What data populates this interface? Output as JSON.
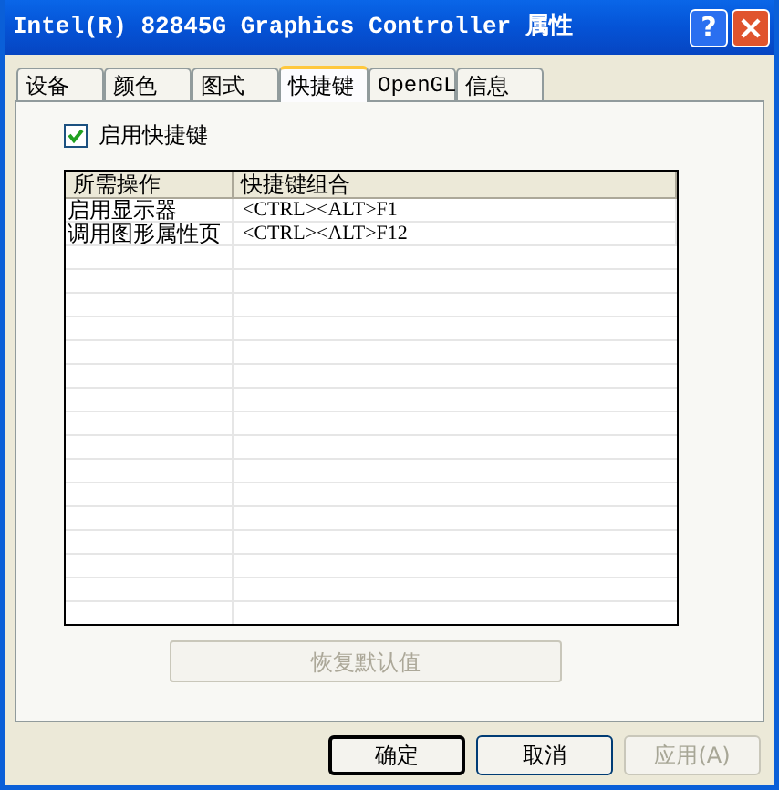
{
  "window": {
    "title": "Intel(R) 82845G Graphics Controller 属性",
    "help_button": "?"
  },
  "tabs": [
    {
      "label": "设备",
      "selected": false
    },
    {
      "label": "颜色",
      "selected": false
    },
    {
      "label": "图式",
      "selected": false
    },
    {
      "label": "快捷键",
      "selected": true
    },
    {
      "label": "OpenGL",
      "selected": false
    },
    {
      "label": "信息",
      "selected": false
    }
  ],
  "hotkey_checkbox": {
    "label": "启用快捷键",
    "checked": true
  },
  "table": {
    "columns": [
      "所需操作",
      "快捷键组合"
    ],
    "rows": [
      [
        "启用显示器",
        "<CTRL><ALT>F1"
      ],
      [
        "调用图形属性页",
        "<CTRL><ALT>F12"
      ]
    ]
  },
  "restore_button": {
    "label": "恢复默认值",
    "disabled": true
  },
  "buttons": [
    {
      "label": "确定",
      "default": true,
      "disabled": false
    },
    {
      "label": "取消",
      "default": false,
      "disabled": false
    },
    {
      "label": "应用(A)",
      "default": false,
      "disabled": true
    }
  ]
}
